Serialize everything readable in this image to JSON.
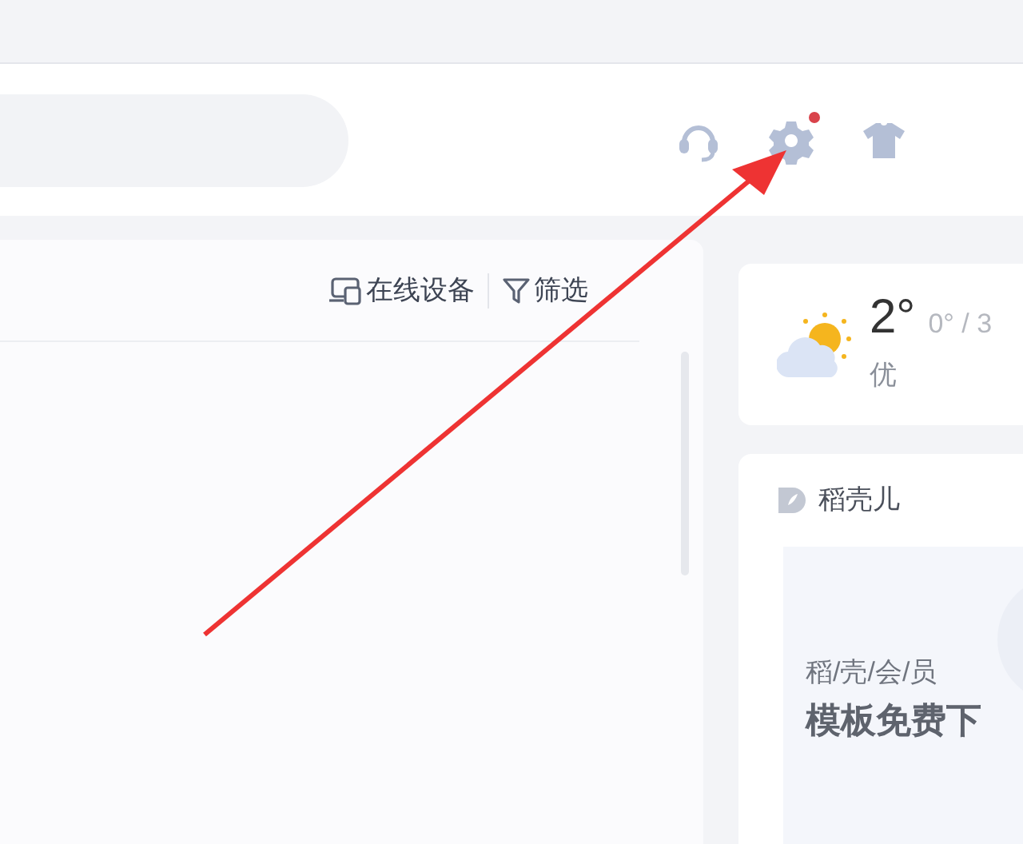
{
  "header": {
    "icons": [
      {
        "kind": "headset",
        "badge": false
      },
      {
        "kind": "gear",
        "badge": true
      },
      {
        "kind": "shirt",
        "badge": false
      }
    ]
  },
  "toolbar": {
    "buttons": [
      {
        "kind": "device",
        "label": "在线设备"
      },
      {
        "kind": "filter",
        "label": "筛选"
      }
    ]
  },
  "weather": {
    "temperature": "2°",
    "range": "0° / 3",
    "air_quality": "优"
  },
  "promo_card": {
    "title": "稻壳儿",
    "tagline": "稻/壳/会/员",
    "headline": "模板免费下"
  }
}
